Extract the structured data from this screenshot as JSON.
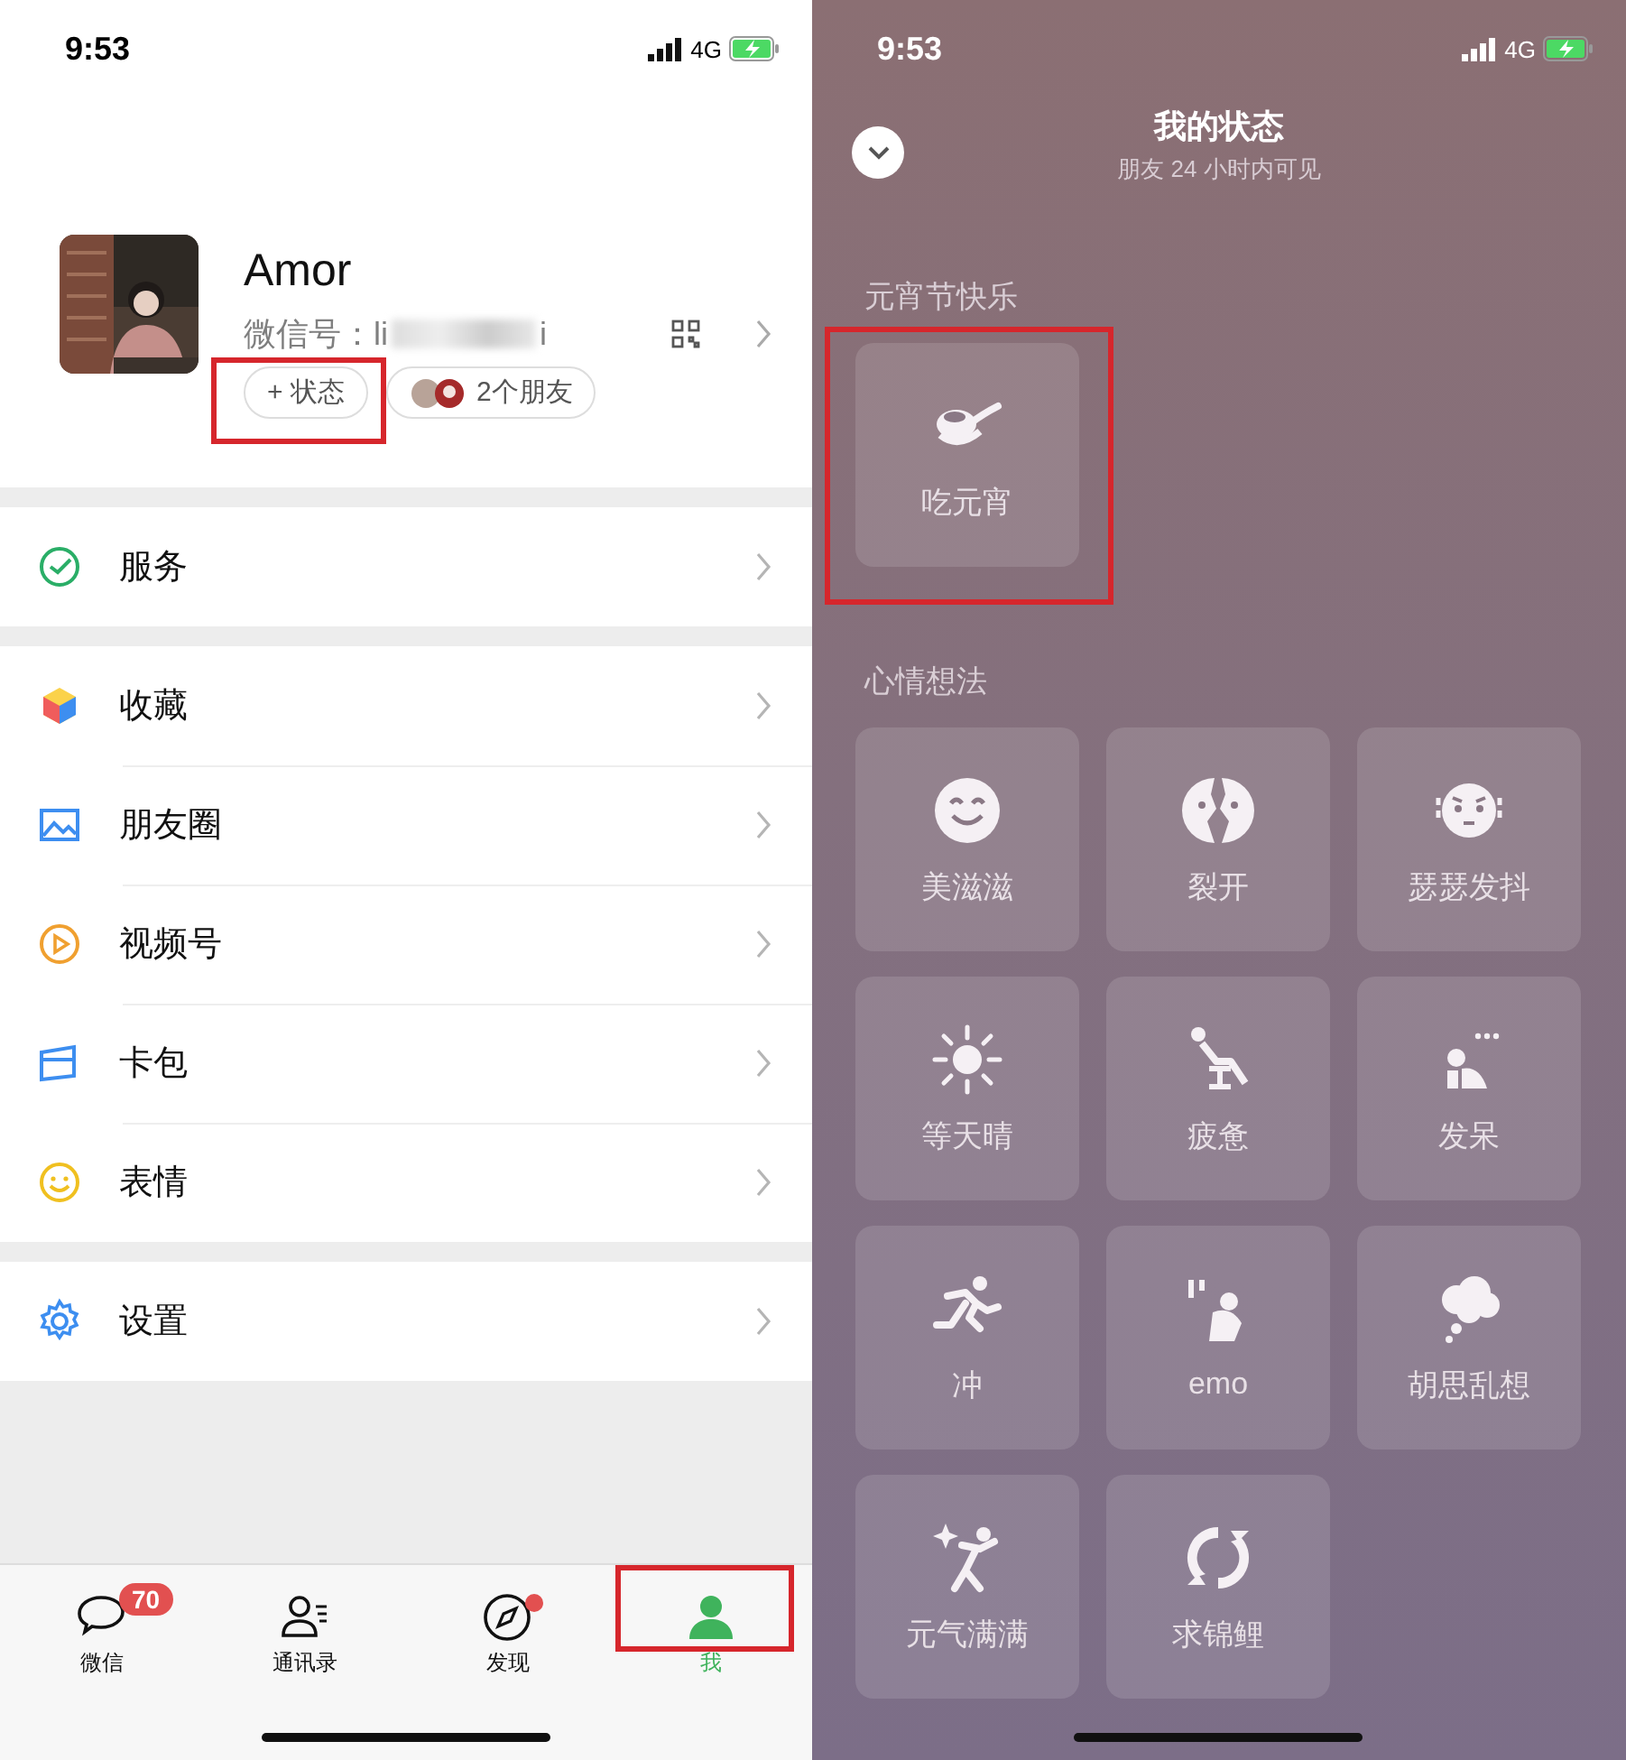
{
  "left_screen": {
    "status_bar": {
      "time": "9:53",
      "network": "4G"
    },
    "profile": {
      "name": "Amor",
      "id_label": "微信号：",
      "id_start": "li",
      "id_end": "i",
      "status_button": {
        "label": "+ 状态",
        "highlighted": true
      },
      "friends_chip": {
        "label": "2个朋友"
      }
    },
    "menu_groups": [
      [
        {
          "label": "服务"
        }
      ],
      [
        {
          "label": "收藏"
        },
        {
          "label": "朋友圈"
        },
        {
          "label": "视频号"
        },
        {
          "label": "卡包"
        },
        {
          "label": "表情"
        }
      ],
      [
        {
          "label": "设置"
        }
      ]
    ],
    "tab_bar": [
      {
        "label": "微信",
        "selected": false,
        "badge": "70",
        "dot": false,
        "highlighted": false
      },
      {
        "label": "通讯录",
        "selected": false,
        "dot": false,
        "highlighted": false
      },
      {
        "label": "发现",
        "selected": false,
        "dot": true,
        "highlighted": false
      },
      {
        "label": "我",
        "selected": true,
        "dot": false,
        "highlighted": true
      }
    ]
  },
  "right_screen": {
    "status_bar": {
      "time": "9:53",
      "network": "4G"
    },
    "header": {
      "title": "我的状态",
      "subtitle": "朋友 24 小时内可见"
    },
    "sections": [
      {
        "title": "元宵节快乐",
        "items": [
          {
            "label": "吃元宵",
            "highlighted": true
          }
        ]
      },
      {
        "title": "心情想法",
        "items": [
          {
            "label": "美滋滋",
            "highlighted": false
          },
          {
            "label": "裂开",
            "highlighted": false
          },
          {
            "label": "瑟瑟发抖",
            "highlighted": false
          },
          {
            "label": "等天晴",
            "highlighted": false
          },
          {
            "label": "疲惫",
            "highlighted": false
          },
          {
            "label": "发呆",
            "highlighted": false
          },
          {
            "label": "冲",
            "highlighted": false
          },
          {
            "label": "emo",
            "highlighted": false
          },
          {
            "label": "胡思乱想",
            "highlighted": false
          },
          {
            "label": "元气满满",
            "highlighted": false
          },
          {
            "label": "求锦鲤",
            "highlighted": false
          }
        ]
      }
    ]
  }
}
